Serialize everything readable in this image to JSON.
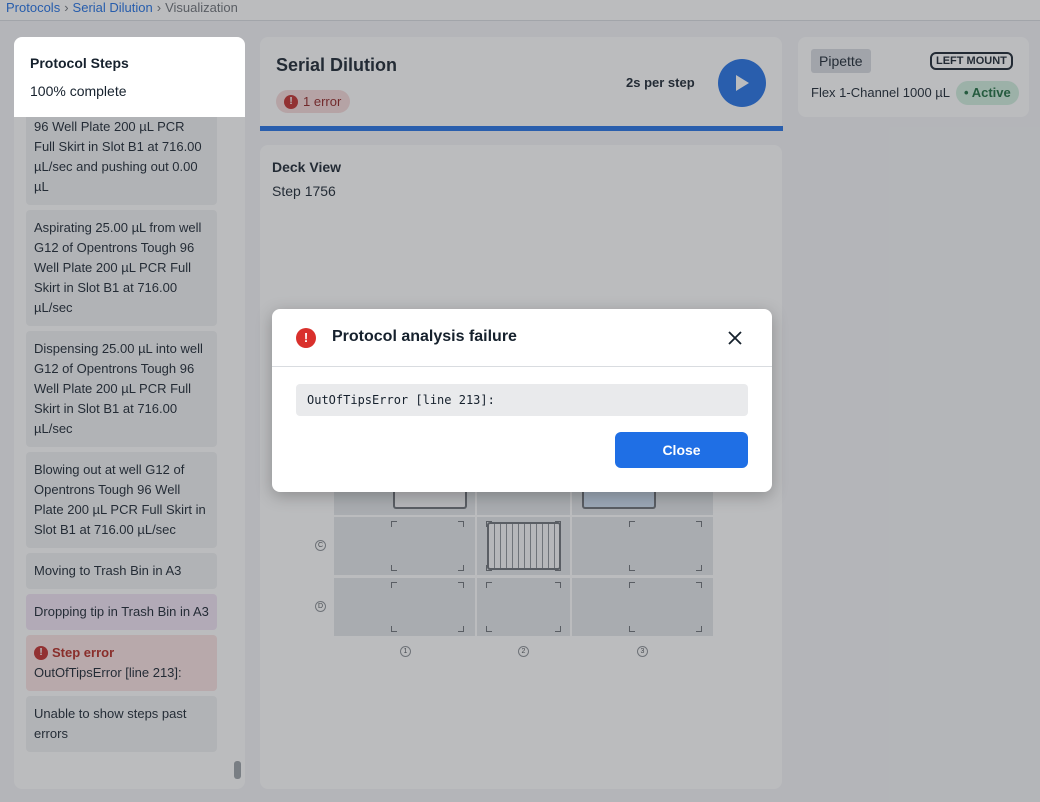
{
  "breadcrumb": {
    "items": [
      "Protocols",
      "Serial Dilution"
    ],
    "current": "Visualization"
  },
  "steps_panel": {
    "title": "Protocol Steps",
    "progress": "100% complete",
    "steps": [
      "96 Well Plate 200 µL PCR Full Skirt in Slot B1 at 716.00 µL/sec and pushing out 0.00 µL",
      "Aspirating 25.00 µL from well G12 of Opentrons Tough 96 Well Plate 200 µL PCR Full Skirt in Slot B1 at 716.00 µL/sec",
      "Dispensing 25.00 µL into well G12 of Opentrons Tough 96 Well Plate 200 µL PCR Full Skirt in Slot B1 at 716.00 µL/sec",
      "Blowing out at well G12 of Opentrons Tough 96 Well Plate 200 µL PCR Full Skirt in Slot B1 at 716.00 µL/sec",
      "Moving to Trash Bin in A3"
    ],
    "dropping_step": "Dropping tip in Trash Bin in A3",
    "error_step": {
      "label": "Step error",
      "message": "OutOfTipsError [line 213]:"
    },
    "final_note": "Unable to show steps past errors"
  },
  "header": {
    "title": "Serial Dilution",
    "error_badge": "1 error",
    "speed": "2s per step",
    "progress_fraction": 1.0
  },
  "deck": {
    "title": "Deck View",
    "step": "Step 1756",
    "row_labels": [
      "C",
      "D"
    ],
    "col_labels": [
      "1",
      "2",
      "3"
    ]
  },
  "pipette": {
    "tag": "Pipette",
    "mount": "LEFT MOUNT",
    "name": "Flex 1-Channel 1000 µL",
    "status": "Active"
  },
  "modal": {
    "title": "Protocol analysis failure",
    "error_code": "OutOfTipsError [line 213]:",
    "close_label": "Close"
  },
  "colors": {
    "accent": "#1f6fe5",
    "error": "#d9302c",
    "dropping_bg": "#f2e3f5",
    "error_bg": "#fbe2e2",
    "active": "#1a6b3c"
  }
}
